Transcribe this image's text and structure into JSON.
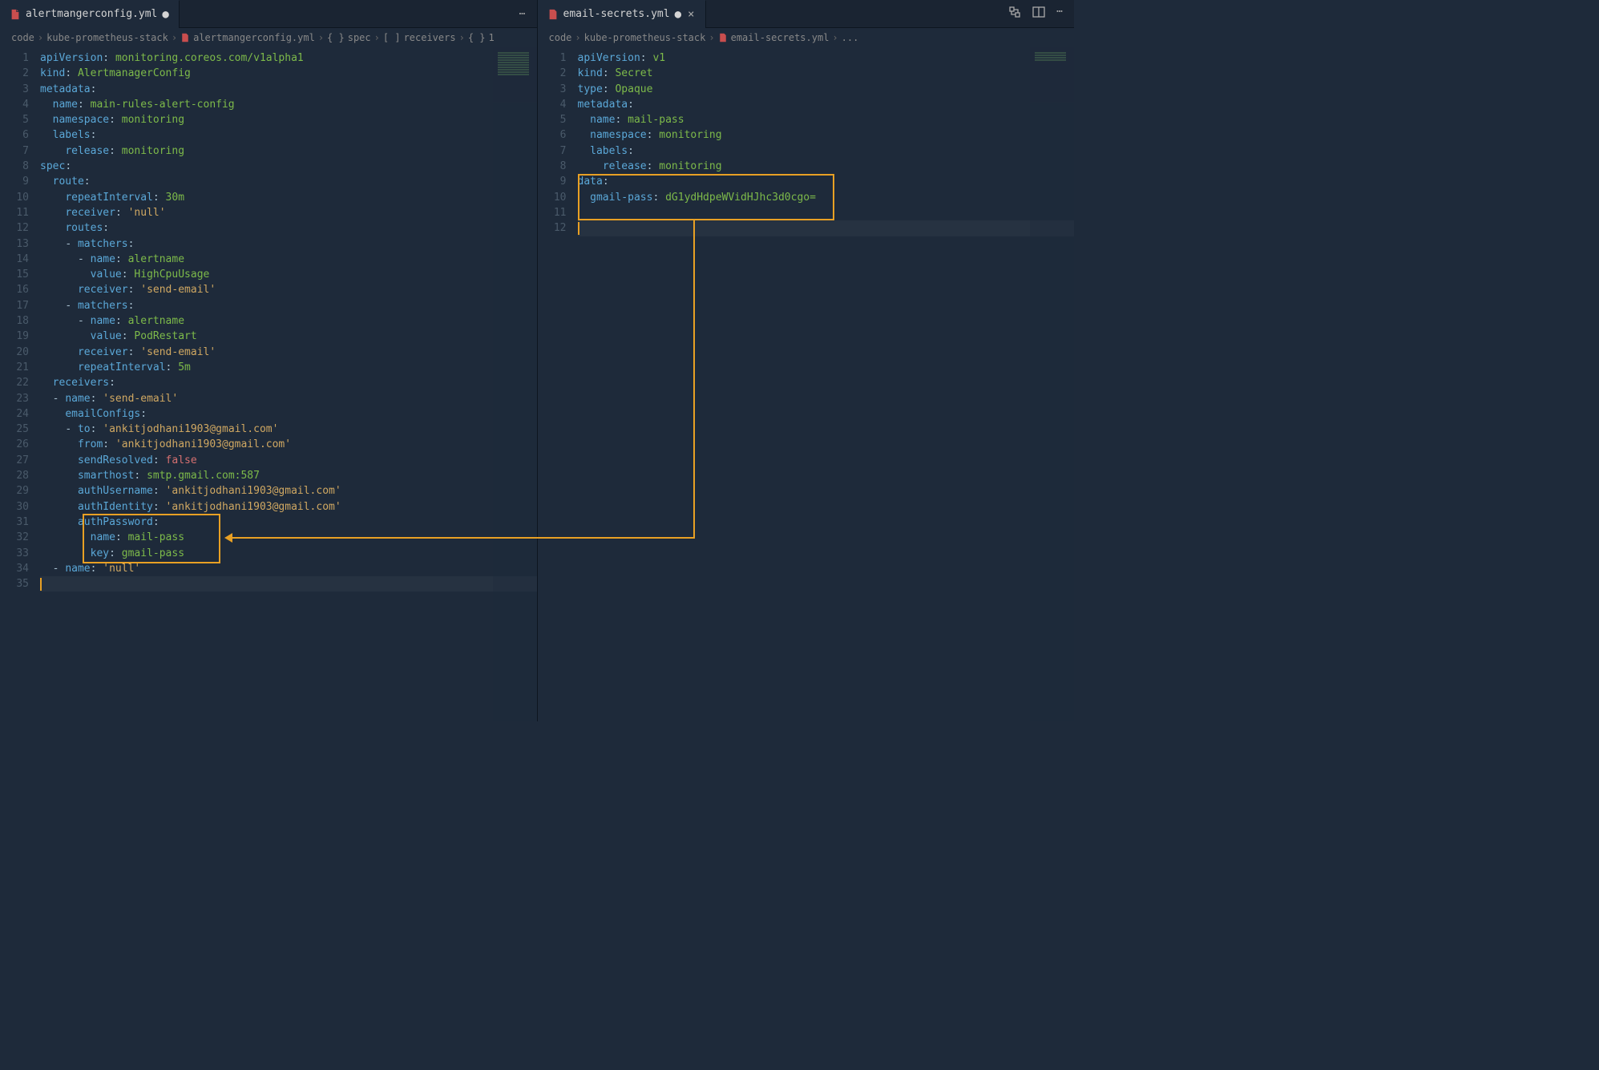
{
  "left": {
    "tab": {
      "filename": "alertmangerconfig.yml",
      "modified": true
    },
    "breadcrumbs": [
      "code",
      "kube-prometheus-stack",
      "alertmangerconfig.yml",
      "spec",
      "receivers",
      "1"
    ],
    "lines": [
      {
        "n": 1,
        "t": [
          [
            "key",
            "apiVersion"
          ],
          [
            "punct",
            ": "
          ],
          [
            "unq",
            "monitoring.coreos.com/v1alpha1"
          ]
        ]
      },
      {
        "n": 2,
        "t": [
          [
            "key",
            "kind"
          ],
          [
            "punct",
            ": "
          ],
          [
            "unq",
            "AlertmanagerConfig"
          ]
        ]
      },
      {
        "n": 3,
        "t": [
          [
            "key",
            "metadata"
          ],
          [
            "punct",
            ":"
          ]
        ]
      },
      {
        "n": 4,
        "i": 1,
        "t": [
          [
            "key",
            "name"
          ],
          [
            "punct",
            ": "
          ],
          [
            "unq",
            "main-rules-alert-config"
          ]
        ]
      },
      {
        "n": 5,
        "i": 1,
        "t": [
          [
            "key",
            "namespace"
          ],
          [
            "punct",
            ": "
          ],
          [
            "unq",
            "monitoring"
          ]
        ]
      },
      {
        "n": 6,
        "i": 1,
        "t": [
          [
            "key",
            "labels"
          ],
          [
            "punct",
            ":"
          ]
        ]
      },
      {
        "n": 7,
        "i": 2,
        "t": [
          [
            "key",
            "release"
          ],
          [
            "punct",
            ": "
          ],
          [
            "unq",
            "monitoring"
          ]
        ]
      },
      {
        "n": 8,
        "t": [
          [
            "key",
            "spec"
          ],
          [
            "punct",
            ":"
          ]
        ]
      },
      {
        "n": 9,
        "i": 1,
        "t": [
          [
            "key",
            "route"
          ],
          [
            "punct",
            ":"
          ]
        ]
      },
      {
        "n": 10,
        "i": 2,
        "t": [
          [
            "key",
            "repeatInterval"
          ],
          [
            "punct",
            ": "
          ],
          [
            "unq",
            "30m"
          ]
        ]
      },
      {
        "n": 11,
        "i": 2,
        "t": [
          [
            "key",
            "receiver"
          ],
          [
            "punct",
            ": "
          ],
          [
            "str",
            "'null'"
          ]
        ]
      },
      {
        "n": 12,
        "i": 2,
        "t": [
          [
            "key",
            "routes"
          ],
          [
            "punct",
            ":"
          ]
        ]
      },
      {
        "n": 13,
        "i": 2,
        "t": [
          [
            "punct",
            "- "
          ],
          [
            "key",
            "matchers"
          ],
          [
            "punct",
            ":"
          ]
        ]
      },
      {
        "n": 14,
        "i": 3,
        "t": [
          [
            "punct",
            "- "
          ],
          [
            "key",
            "name"
          ],
          [
            "punct",
            ": "
          ],
          [
            "unq",
            "alertname"
          ]
        ]
      },
      {
        "n": 15,
        "i": 4,
        "t": [
          [
            "key",
            "value"
          ],
          [
            "punct",
            ": "
          ],
          [
            "unq",
            "HighCpuUsage"
          ]
        ]
      },
      {
        "n": 16,
        "i": 3,
        "t": [
          [
            "key",
            "receiver"
          ],
          [
            "punct",
            ": "
          ],
          [
            "str",
            "'send-email'"
          ]
        ]
      },
      {
        "n": 17,
        "i": 2,
        "t": [
          [
            "punct",
            "- "
          ],
          [
            "key",
            "matchers"
          ],
          [
            "punct",
            ":"
          ]
        ]
      },
      {
        "n": 18,
        "i": 3,
        "t": [
          [
            "punct",
            "- "
          ],
          [
            "key",
            "name"
          ],
          [
            "punct",
            ": "
          ],
          [
            "unq",
            "alertname"
          ]
        ]
      },
      {
        "n": 19,
        "i": 4,
        "t": [
          [
            "key",
            "value"
          ],
          [
            "punct",
            ": "
          ],
          [
            "unq",
            "PodRestart"
          ]
        ]
      },
      {
        "n": 20,
        "i": 3,
        "t": [
          [
            "key",
            "receiver"
          ],
          [
            "punct",
            ": "
          ],
          [
            "str",
            "'send-email'"
          ]
        ]
      },
      {
        "n": 21,
        "i": 3,
        "t": [
          [
            "key",
            "repeatInterval"
          ],
          [
            "punct",
            ": "
          ],
          [
            "unq",
            "5m"
          ]
        ]
      },
      {
        "n": 22,
        "i": 1,
        "t": [
          [
            "key",
            "receivers"
          ],
          [
            "punct",
            ":"
          ]
        ]
      },
      {
        "n": 23,
        "i": 1,
        "t": [
          [
            "punct",
            "- "
          ],
          [
            "key",
            "name"
          ],
          [
            "punct",
            ": "
          ],
          [
            "str",
            "'send-email'"
          ]
        ]
      },
      {
        "n": 24,
        "i": 2,
        "t": [
          [
            "key",
            "emailConfigs"
          ],
          [
            "punct",
            ":"
          ]
        ]
      },
      {
        "n": 25,
        "i": 2,
        "t": [
          [
            "punct",
            "- "
          ],
          [
            "key",
            "to"
          ],
          [
            "punct",
            ": "
          ],
          [
            "str",
            "'ankitjodhani1903@gmail.com'"
          ]
        ]
      },
      {
        "n": 26,
        "i": 3,
        "t": [
          [
            "key",
            "from"
          ],
          [
            "punct",
            ": "
          ],
          [
            "str",
            "'ankitjodhani1903@gmail.com'"
          ]
        ]
      },
      {
        "n": 27,
        "i": 3,
        "t": [
          [
            "key",
            "sendResolved"
          ],
          [
            "punct",
            ": "
          ],
          [
            "bool",
            "false"
          ]
        ]
      },
      {
        "n": 28,
        "i": 3,
        "t": [
          [
            "key",
            "smarthost"
          ],
          [
            "punct",
            ": "
          ],
          [
            "unq",
            "smtp.gmail.com:587"
          ]
        ]
      },
      {
        "n": 29,
        "i": 3,
        "t": [
          [
            "key",
            "authUsername"
          ],
          [
            "punct",
            ": "
          ],
          [
            "str",
            "'ankitjodhani1903@gmail.com'"
          ]
        ]
      },
      {
        "n": 30,
        "i": 3,
        "t": [
          [
            "key",
            "authIdentity"
          ],
          [
            "punct",
            ": "
          ],
          [
            "str",
            "'ankitjodhani1903@gmail.com'"
          ]
        ]
      },
      {
        "n": 31,
        "i": 3,
        "t": [
          [
            "key",
            "authPassword"
          ],
          [
            "punct",
            ":"
          ]
        ]
      },
      {
        "n": 32,
        "i": 4,
        "t": [
          [
            "key",
            "name"
          ],
          [
            "punct",
            ": "
          ],
          [
            "unq",
            "mail-pass"
          ]
        ]
      },
      {
        "n": 33,
        "i": 4,
        "t": [
          [
            "key",
            "key"
          ],
          [
            "punct",
            ": "
          ],
          [
            "unq",
            "gmail-pass"
          ]
        ]
      },
      {
        "n": 34,
        "i": 1,
        "t": [
          [
            "punct",
            "- "
          ],
          [
            "key",
            "name"
          ],
          [
            "punct",
            ": "
          ],
          [
            "str",
            "'null'"
          ]
        ]
      },
      {
        "n": 35,
        "cursor": true,
        "t": []
      }
    ]
  },
  "right": {
    "tab": {
      "filename": "email-secrets.yml",
      "modified": true
    },
    "breadcrumbs": [
      "code",
      "kube-prometheus-stack",
      "email-secrets.yml",
      "..."
    ],
    "lines": [
      {
        "n": 1,
        "t": [
          [
            "key",
            "apiVersion"
          ],
          [
            "punct",
            ": "
          ],
          [
            "unq",
            "v1"
          ]
        ]
      },
      {
        "n": 2,
        "t": [
          [
            "key",
            "kind"
          ],
          [
            "punct",
            ": "
          ],
          [
            "unq",
            "Secret"
          ]
        ]
      },
      {
        "n": 3,
        "t": [
          [
            "key",
            "type"
          ],
          [
            "punct",
            ": "
          ],
          [
            "unq",
            "Opaque"
          ]
        ]
      },
      {
        "n": 4,
        "t": [
          [
            "key",
            "metadata"
          ],
          [
            "punct",
            ":"
          ]
        ]
      },
      {
        "n": 5,
        "i": 1,
        "t": [
          [
            "key",
            "name"
          ],
          [
            "punct",
            ": "
          ],
          [
            "unq",
            "mail-pass"
          ]
        ]
      },
      {
        "n": 6,
        "i": 1,
        "t": [
          [
            "key",
            "namespace"
          ],
          [
            "punct",
            ": "
          ],
          [
            "unq",
            "monitoring"
          ]
        ]
      },
      {
        "n": 7,
        "i": 1,
        "t": [
          [
            "key",
            "labels"
          ],
          [
            "punct",
            ":"
          ]
        ]
      },
      {
        "n": 8,
        "i": 2,
        "t": [
          [
            "key",
            "release"
          ],
          [
            "punct",
            ": "
          ],
          [
            "unq",
            "monitoring"
          ]
        ]
      },
      {
        "n": 9,
        "t": [
          [
            "key",
            "data"
          ],
          [
            "punct",
            ":"
          ]
        ]
      },
      {
        "n": 10,
        "i": 1,
        "t": [
          [
            "key",
            "gmail-pass"
          ],
          [
            "punct",
            ": "
          ],
          [
            "unq",
            "dG1ydHdpeWVidHJhc3d0cgo="
          ]
        ]
      },
      {
        "n": 11,
        "t": []
      },
      {
        "n": 12,
        "cursor": true,
        "t": []
      }
    ]
  },
  "colors": {
    "highlight": "#e8a024"
  }
}
